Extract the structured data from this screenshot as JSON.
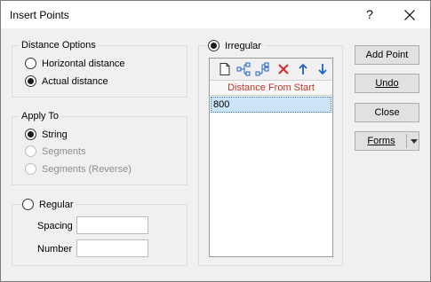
{
  "window": {
    "title": "Insert Points",
    "help_label": "?",
    "close_icon": "close-icon"
  },
  "distance_options": {
    "label": "Distance Options",
    "options": [
      {
        "label": "Horizontal distance",
        "checked": false
      },
      {
        "label": "Actual distance",
        "checked": true
      }
    ]
  },
  "apply_to": {
    "label": "Apply To",
    "options": [
      {
        "label": "String",
        "checked": true,
        "enabled": true
      },
      {
        "label": "Segments",
        "checked": false,
        "enabled": false
      },
      {
        "label": "Segments (Reverse)",
        "checked": false,
        "enabled": false
      }
    ]
  },
  "regular": {
    "label": "Regular",
    "checked": false,
    "spacing_label": "Spacing",
    "spacing_value": "",
    "number_label": "Number",
    "number_value": ""
  },
  "irregular": {
    "label": "Irregular",
    "checked": true,
    "toolbar_icons": [
      "new-icon",
      "insert-row-icon",
      "append-row-icon",
      "delete-icon",
      "move-up-icon",
      "move-down-icon"
    ],
    "column_header": "Distance From Start",
    "rows": [
      "800"
    ]
  },
  "buttons": {
    "add_point": "Add Point",
    "undo": "Undo",
    "close": "Close",
    "forms": "Forms"
  },
  "colors": {
    "header_text": "#c0392b",
    "delete_icon": "#d9262b",
    "arrow_icon": "#1e62c9",
    "selection": "#cce4f7"
  }
}
